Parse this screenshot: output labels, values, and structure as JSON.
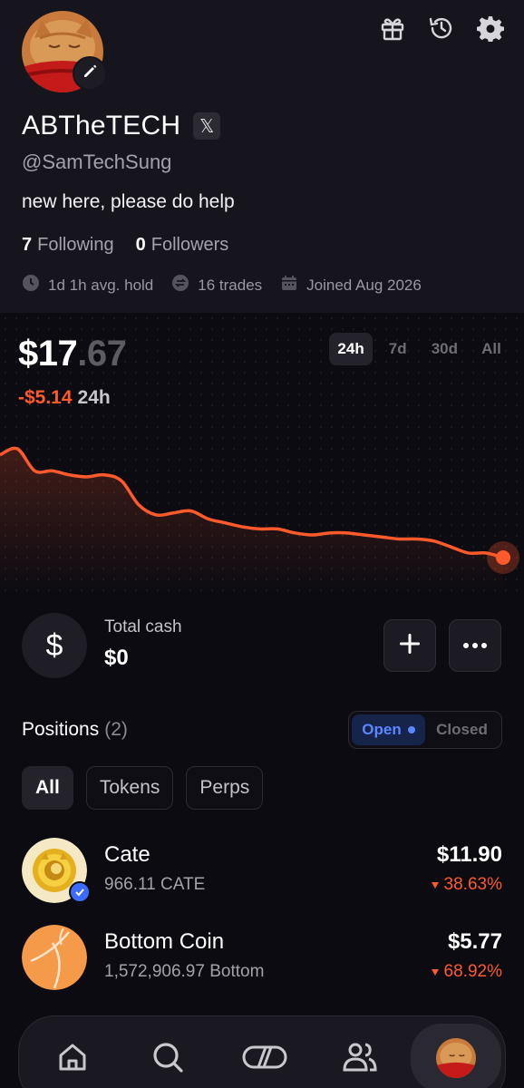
{
  "profile": {
    "display_name": "ABTheTECH",
    "x_badge": "𝕏",
    "handle": "@SamTechSung",
    "bio": "new here, please do help",
    "following_count": "7",
    "following_label": "Following",
    "followers_count": "0",
    "followers_label": "Followers",
    "avg_hold": "1d 1h avg. hold",
    "trades": "16 trades",
    "joined": "Joined Aug 2026",
    "top_icons": [
      "gift-icon",
      "history-icon",
      "settings-icon"
    ]
  },
  "portfolio": {
    "balance_whole": "$17",
    "balance_cents": ".67",
    "change_value": "-$5.14",
    "change_period": "24h",
    "ranges": [
      "24h",
      "7d",
      "30d",
      "All"
    ],
    "active_range": "24h"
  },
  "chart_data": {
    "type": "line",
    "series": [
      {
        "values": [
          22.8,
          23.1,
          22.0,
          22.0,
          21.8,
          21.7,
          21.8,
          21.5,
          20.3,
          19.8,
          19.9,
          20.0,
          19.6,
          19.4,
          19.2,
          19.1,
          19.1,
          18.9,
          18.8,
          18.9,
          18.9,
          18.8,
          18.7,
          18.6,
          18.6,
          18.5,
          18.2,
          17.9,
          17.9,
          17.67
        ]
      }
    ],
    "colors": {
      "line": "#ff5a2c",
      "fill_top": "rgba(255,90,44,0.22)"
    },
    "xlabel": "",
    "ylabel": ""
  },
  "cash": {
    "symbol": "$",
    "label": "Total cash",
    "value": "$0",
    "add_label": "+",
    "more_label": "•••"
  },
  "positions": {
    "title": "Positions",
    "count": "(2)",
    "segments": {
      "open": "Open",
      "closed": "Closed"
    },
    "filters": [
      "All",
      "Tokens",
      "Perps"
    ],
    "items": [
      {
        "name": "Cate",
        "amount": "966.11 CATE",
        "value": "$11.90",
        "change": "38.63%"
      },
      {
        "name": "Bottom Coin",
        "amount": "1,572,906.97 Bottom",
        "value": "$5.77",
        "change": "68.92%"
      }
    ]
  },
  "nav": {
    "items": [
      "home-icon",
      "search-icon",
      "trade-icon",
      "social-icon",
      "profile-avatar"
    ],
    "active": "profile-avatar"
  },
  "colors": {
    "accent_negative": "#ff5a2c",
    "accent_blue": "#5b86ff",
    "background": "#0c0b12",
    "header_bg": "#16151d"
  }
}
